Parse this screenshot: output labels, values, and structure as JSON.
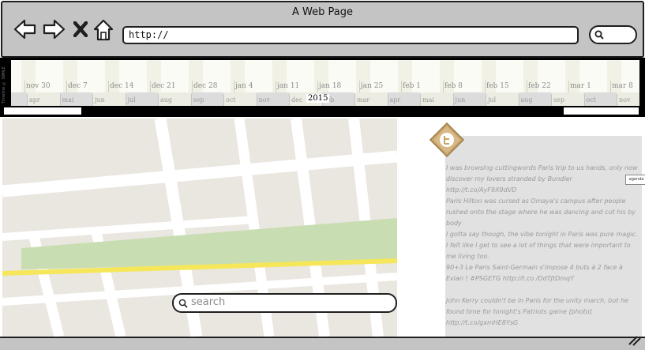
{
  "window": {
    "title": "A Web Page"
  },
  "toolbar": {
    "back_icon": "back-arrow-icon",
    "forward_icon": "forward-arrow-icon",
    "stop_icon": "close-x-icon",
    "home_icon": "home-icon",
    "url": "http://",
    "search_icon": "search-icon"
  },
  "timeline": {
    "vertical_label": "Timeline © SIMILE",
    "upper_labels": [
      "nov 30",
      "dec 7",
      "dec 14",
      "dec 21",
      "dec 28",
      "jan 4",
      "jan 11",
      "jan 18",
      "jan 25",
      "feb 1",
      "feb 8",
      "feb 15",
      "feb 22",
      "mar 1",
      "mar 8"
    ],
    "lower_labels": [
      "apr",
      "mai",
      "jun",
      "jul",
      "aug",
      "sep",
      "oct",
      "nov",
      "dec",
      "feb",
      "mar",
      "apr",
      "mai",
      "jun",
      "jul",
      "aug",
      "sep",
      "oct",
      "nov"
    ],
    "year": "2015"
  },
  "map": {
    "search_placeholder": "search"
  },
  "feed": {
    "agenda_label": "agenda",
    "items": [
      "I was browsing cuttingwords Paris trip to us hands, only now discover my lovers stranded by Bundler http://t.co/AyF9X9dVD",
      "Paris Hilton was cursed as Omaya's campus after people rushed onto the stage where he was dancing and cut his by body",
      "I gotta say though, the vibe tonight in Paris was pure magic. I felt like I get to see a lot of things that were important to me living too.",
      "90+3 Le Paris Saint-Germain s'impose 4 buts à 2 face à Evian ! #PSGETG http://t.co /DdTJtDmqY",
      "John Kerry couldn't be in Paris for the unity march, but he found time for tonight's Patriots game [photo] http://t.co/gxmHE8YsG"
    ]
  },
  "colors": {
    "chrome": "#c4c4c4",
    "map_land": "#eae6e0",
    "map_park": "#c9ddb3",
    "map_road_major": "#f6e75a",
    "feed_card": "#e1e1e1"
  }
}
